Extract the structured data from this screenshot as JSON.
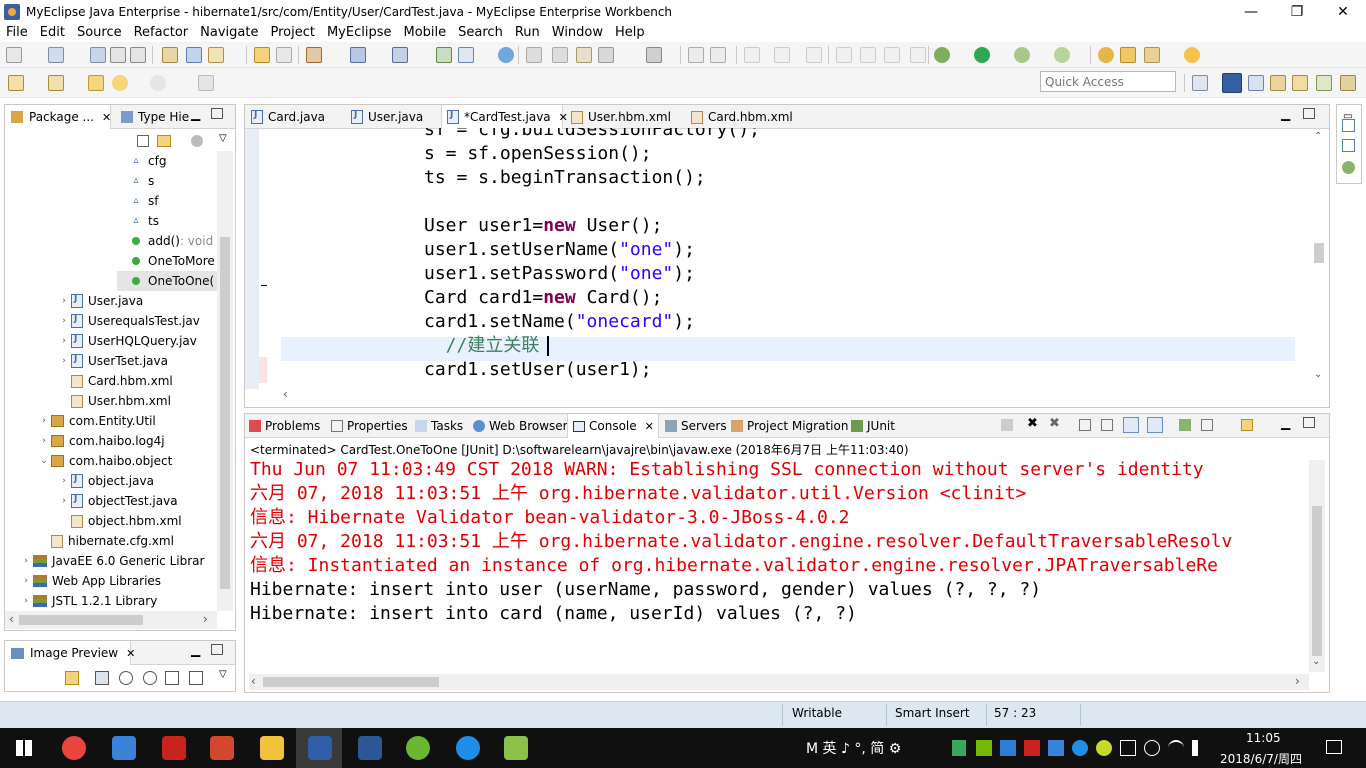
{
  "window": {
    "title": "MyEclipse Java Enterprise - hibernate1/src/com/Entity/User/CardTest.java - MyEclipse Enterprise Workbench",
    "minimize": "—",
    "maximize": "❐",
    "close": "✕"
  },
  "menu": [
    "File",
    "Edit",
    "Source",
    "Refactor",
    "Navigate",
    "Project",
    "MyEclipse",
    "Mobile",
    "Search",
    "Run",
    "Window",
    "Help"
  ],
  "quick_access": {
    "placeholder": "Quick Access"
  },
  "left_tabs": {
    "package": "Package ...",
    "type_hier": "Type Hie"
  },
  "tree": [
    {
      "label": "cfg",
      "icon": "field-icon",
      "indent": 130
    },
    {
      "label": "s",
      "icon": "field-icon",
      "indent": 130
    },
    {
      "label": "sf",
      "icon": "field-icon",
      "indent": 130
    },
    {
      "label": "ts",
      "icon": "field-icon",
      "indent": 130
    },
    {
      "label": "add()",
      "suffix": " : void",
      "icon": "method-icon",
      "indent": 130
    },
    {
      "label": "OneToMore",
      "icon": "method-icon",
      "indent": 130
    },
    {
      "label": "OneToOne(",
      "icon": "method-icon",
      "indent": 130,
      "selected": true
    },
    {
      "label": "User.java",
      "icon": "java-file-icon",
      "indent": 72,
      "expand": "›"
    },
    {
      "label": "UserequalsTest.jav",
      "icon": "java-file-icon",
      "indent": 72,
      "expand": "›"
    },
    {
      "label": "UserHQLQuery.jav",
      "icon": "java-file-icon",
      "indent": 72,
      "expand": "›"
    },
    {
      "label": "UserTset.java",
      "icon": "java-file-icon",
      "indent": 72,
      "expand": "›"
    },
    {
      "label": "Card.hbm.xml",
      "icon": "xml-file-icon",
      "indent": 72
    },
    {
      "label": "User.hbm.xml",
      "icon": "xml-file-icon",
      "indent": 72
    },
    {
      "label": "com.Entity.Util",
      "icon": "package-icon",
      "indent": 52,
      "expand": "›"
    },
    {
      "label": "com.haibo.log4j",
      "icon": "package-icon",
      "indent": 52,
      "expand": "›"
    },
    {
      "label": "com.haibo.object",
      "icon": "package-icon",
      "indent": 52,
      "expand": "⌄"
    },
    {
      "label": "object.java",
      "icon": "java-file-icon",
      "indent": 72,
      "expand": "›"
    },
    {
      "label": "objectTest.java",
      "icon": "java-file-icon",
      "indent": 72,
      "expand": "›"
    },
    {
      "label": "object.hbm.xml",
      "icon": "xml-file-icon",
      "indent": 72
    },
    {
      "label": "hibernate.cfg.xml",
      "icon": "xml-file-icon",
      "indent": 52
    },
    {
      "label": "JavaEE 6.0 Generic Librar",
      "icon": "library-icon",
      "indent": 34,
      "expand": "›"
    },
    {
      "label": "Web App Libraries",
      "icon": "library-icon",
      "indent": 34,
      "expand": "›"
    },
    {
      "label": "JSTL 1.2.1 Library",
      "icon": "library-icon",
      "indent": 34,
      "expand": "›"
    }
  ],
  "image_preview": {
    "title": "Image Preview"
  },
  "editor_tabs": [
    {
      "label": "Card.java",
      "icon": "java-file-icon",
      "active": false
    },
    {
      "label": "User.java",
      "icon": "java-file-icon",
      "active": false
    },
    {
      "label": "*CardTest.java",
      "icon": "java-file-icon",
      "active": true,
      "close": "✕"
    },
    {
      "label": "User.hbm.xml",
      "icon": "xml-file-icon",
      "active": false
    },
    {
      "label": "Card.hbm.xml",
      "icon": "xml-file-icon",
      "active": false
    }
  ],
  "code": {
    "l0": {
      "a": "sf = cfg.buildSessionFactory();"
    },
    "l1": {
      "a": "s = sf.openSession();"
    },
    "l2": {
      "a": "ts = s.beginTransaction();"
    },
    "l4": {
      "a": "User user1=",
      "kw": "new",
      "b": " User();"
    },
    "l5": {
      "a": "user1.setUserName(",
      "s": "\"one\"",
      "b": ");"
    },
    "l6": {
      "a": "user1.setPassword(",
      "s": "\"one\"",
      "b": ");"
    },
    "l7": {
      "a": "Card card1=",
      "kw": "new",
      "b": " Card();"
    },
    "l8": {
      "a": "card1.setName(",
      "s": "\"onecard\"",
      "b": ");"
    },
    "l9": {
      "c": "  //建立关联"
    },
    "l10": {
      "a": "card1.setUser(user1);"
    }
  },
  "bottom_tabs": [
    "Problems",
    "Properties",
    "Tasks",
    "Web Browser",
    "Console",
    "Servers",
    "Project Migration",
    "JUnit"
  ],
  "console": {
    "header": "<terminated> CardTest.OneToOne [JUnit] D:\\softwarelearn\\javajre\\bin\\javaw.exe (2018年6月7日 上午11:03:40)",
    "lines": [
      {
        "text": "Thu Jun 07 11:03:49 CST 2018 WARN: Establishing SSL connection without server's identity",
        "red": true
      },
      {
        "text": "六月 07, 2018 11:03:51 上午 org.hibernate.validator.util.Version <clinit>",
        "red": true
      },
      {
        "text": "信息: Hibernate Validator bean-validator-3.0-JBoss-4.0.2",
        "red": true
      },
      {
        "text": "六月 07, 2018 11:03:51 上午 org.hibernate.validator.engine.resolver.DefaultTraversableResolv",
        "red": true
      },
      {
        "text": "信息: Instantiated an instance of org.hibernate.validator.engine.resolver.JPATraversableRe",
        "red": true
      },
      {
        "text": "Hibernate: insert into user (userName, password, gender) values (?, ?, ?)",
        "red": false
      },
      {
        "text": "Hibernate: insert into card (name, userId) values (?, ?)",
        "red": false
      }
    ]
  },
  "status": {
    "writable": "Writable",
    "insert_mode": "Smart Insert",
    "position": "57 : 23"
  },
  "taskbar": {
    "ime": "M 英 ♪ °, 简 ⚙",
    "time": "11:05",
    "date": "2018/6/7/周四"
  },
  "colors": {
    "accent": "#3399ff",
    "keyword": "#7f0055",
    "string": "#2a00ff",
    "comment": "#3f7f5f",
    "console_error": "#e00000",
    "status_bg": "#dde7f2",
    "taskbar": "#101010"
  }
}
